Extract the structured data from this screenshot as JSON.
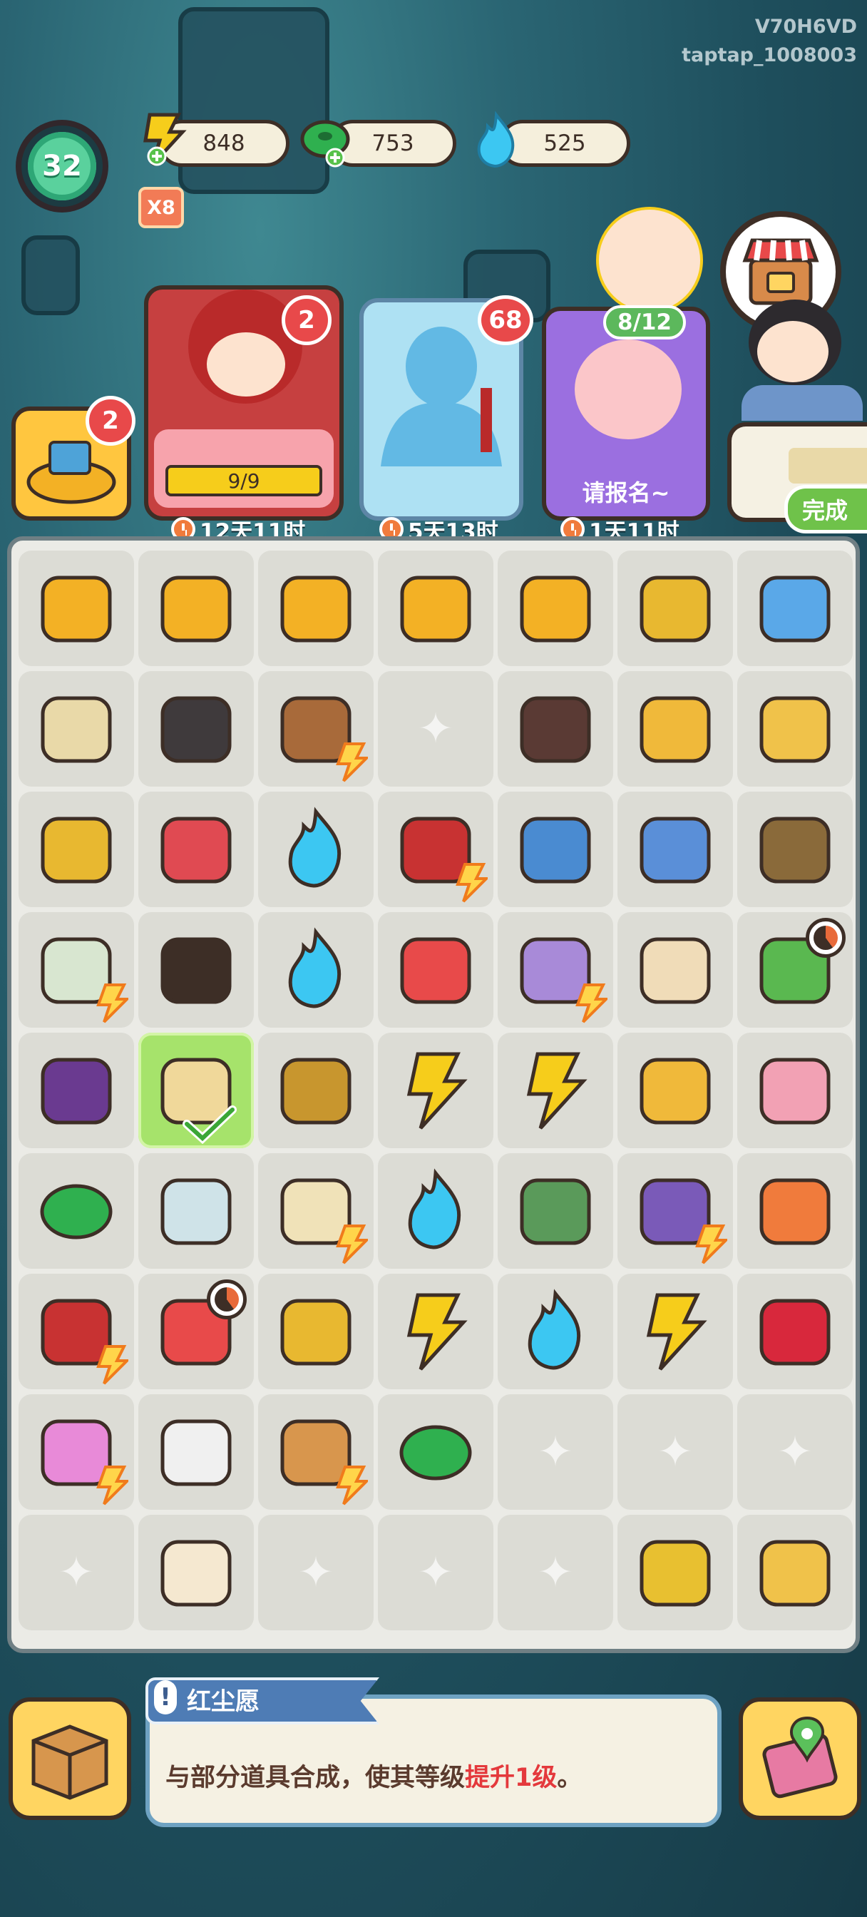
{
  "watermark": {
    "line1": "V70H6VD",
    "line2": "taptap_1008003"
  },
  "player": {
    "level": "32"
  },
  "resources": [
    {
      "name": "energy",
      "icon": "lightning-icon",
      "value": "848",
      "color": "#f6cd1b"
    },
    {
      "name": "jade-coin",
      "icon": "jade-coin-icon",
      "value": "753",
      "color": "#2fb04f"
    },
    {
      "name": "spirit-flame",
      "icon": "blue-flame-icon",
      "value": "525",
      "color": "#3cc7f2"
    }
  ],
  "multiplier": "X8",
  "shop": {
    "icon": "shop-icon"
  },
  "orders": [
    {
      "name": "bag-order",
      "badge": "2"
    },
    {
      "name": "bride-order",
      "badge": "2",
      "progress_text": "9/9",
      "timer": "12天11时"
    },
    {
      "name": "statue-order",
      "badge": "68",
      "timer": "5天13时"
    },
    {
      "name": "npc-order",
      "progress_text": "8/12",
      "label": "请报名~",
      "timer": "1天11时"
    },
    {
      "name": "quest-order",
      "label": "完成"
    }
  ],
  "board": {
    "rows": [
      [
        "treasure-bowl-icon",
        "treasure-bowl-icon",
        "treasure-bowl-icon",
        "treasure-bowl-icon",
        "treasure-bowl-icon",
        "golden-scepter-icon",
        "magic-mirror-icon"
      ],
      [
        "scroll-icon",
        "embroidered-jacket-icon",
        "treasure-chest-icon",
        "",
        "pants-icon",
        "gold-bracelet-icon",
        "honeycomb-icon"
      ],
      [
        "hairpin-icon",
        "red-envelope-icon",
        "blue-flame-icon",
        "red-chest-icon",
        "jade-hairpin-icon",
        "blue-scepter-icon",
        "framed-calligraphy-icon"
      ],
      [
        "brush-pot-icon",
        "black-shoes-icon",
        "blue-flame-icon",
        "red-shoes-icon",
        "jewelry-box-icon",
        "paper-plane-icon",
        "fruit-tree-icon"
      ],
      [
        "grapes-icon",
        "painting-scroll-icon",
        "kiwi-icon",
        "lightning-icon",
        "lightning-icon",
        "golden-crown-icon",
        "lotus-icon"
      ],
      [
        "jade-coin-icon",
        "landscape-scroll-icon",
        "round-table-icon",
        "blue-flame-icon",
        "vertical-scroll-icon",
        "cabinet-icon",
        "lucky-bag-icon"
      ],
      [
        "red-screen-icon",
        "flower-basket-icon",
        "golden-key-icon",
        "lightning-icon",
        "blue-flame-icon",
        "lightning-icon",
        "cherries-icon"
      ],
      [
        "flower-pot-icon",
        "paint-tube-icon",
        "wooden-house-icon",
        "jade-coin-icon",
        "",
        "",
        ""
      ],
      [
        "",
        "folding-fan-icon",
        "",
        "",
        "",
        "gold-brick-icon",
        "honeycomb-icon"
      ]
    ],
    "selected": "painting-scroll-icon"
  },
  "info": {
    "title": "红尘愿",
    "text_before": "与部分道具合成，使其等级",
    "text_highlight": "提升1级",
    "text_after": "。"
  },
  "bottom": {
    "left_icon": "storage-box-icon",
    "right_icon": "map-phone-icon"
  }
}
